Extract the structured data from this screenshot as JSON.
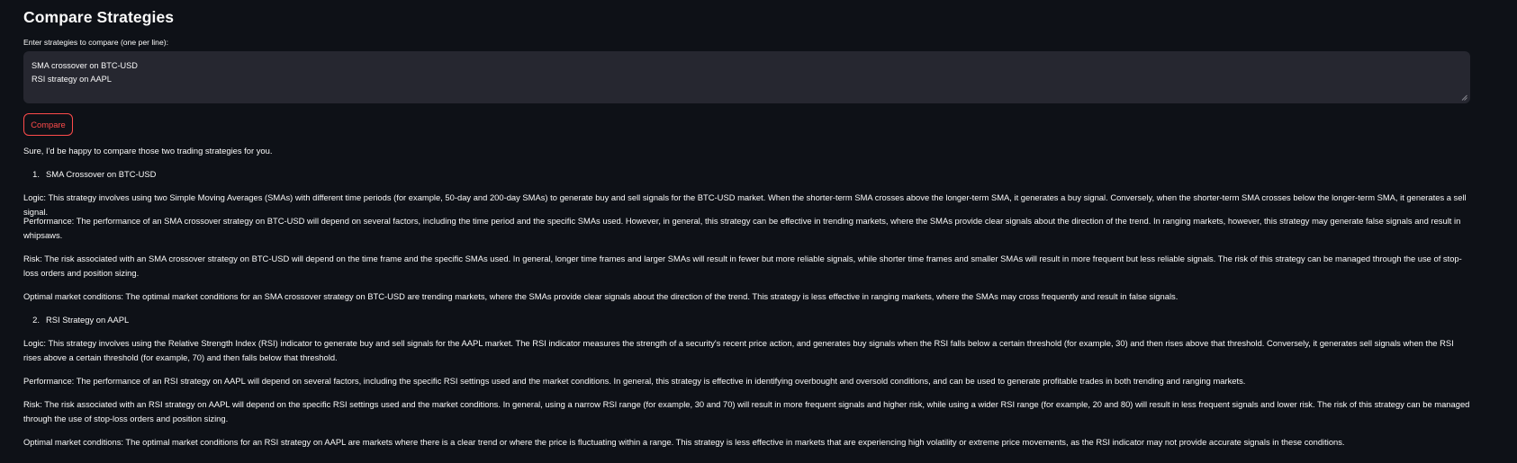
{
  "header": {
    "title": "Compare Strategies"
  },
  "input": {
    "label": "Enter strategies to compare (one per line):",
    "lines": [
      "SMA crossover on BTC-USD",
      "RSI strategy on AAPL"
    ]
  },
  "actions": {
    "compare_label": "Compare"
  },
  "result": {
    "intro": "Sure, I'd be happy to compare those two trading strategies for you.",
    "strategies": [
      {
        "number": "1.",
        "title": "SMA Crossover on BTC-USD",
        "logic": "Logic: This strategy involves using two Simple Moving Averages (SMAs) with different time periods (for example, 50-day and 200-day SMAs) to generate buy and sell signals for the BTC-USD market. When the shorter-term SMA crosses above the longer-term SMA, it generates a buy signal. Conversely, when the shorter-term SMA crosses below the longer-term SMA, it generates a sell signal.",
        "performance": "Performance: The performance of an SMA crossover strategy on BTC-USD will depend on several factors, including the time period and the specific SMAs used. However, in general, this strategy can be effective in trending markets, where the SMAs provide clear signals about the direction of the trend. In ranging markets, however, this strategy may generate false signals and result in whipsaws.",
        "risk": "Risk: The risk associated with an SMA crossover strategy on BTC-USD will depend on the time frame and the specific SMAs used. In general, longer time frames and larger SMAs will result in fewer but more reliable signals, while shorter time frames and smaller SMAs will result in more frequent but less reliable signals. The risk of this strategy can be managed through the use of stop-loss orders and position sizing.",
        "conditions": "Optimal market conditions: The optimal market conditions for an SMA crossover strategy on BTC-USD are trending markets, where the SMAs provide clear signals about the direction of the trend. This strategy is less effective in ranging markets, where the SMAs may cross frequently and result in false signals."
      },
      {
        "number": "2.",
        "title": "RSI Strategy on AAPL",
        "logic": "Logic: This strategy involves using the Relative Strength Index (RSI) indicator to generate buy and sell signals for the AAPL market. The RSI indicator measures the strength of a security's recent price action, and generates buy signals when the RSI falls below a certain threshold (for example, 30) and then rises above that threshold. Conversely, it generates sell signals when the RSI rises above a certain threshold (for example, 70) and then falls below that threshold.",
        "performance": "Performance: The performance of an RSI strategy on AAPL will depend on several factors, including the specific RSI settings used and the market conditions. In general, this strategy is effective in identifying overbought and oversold conditions, and can be used to generate profitable trades in both trending and ranging markets.",
        "risk": "Risk: The risk associated with an RSI strategy on AAPL will depend on the specific RSI settings used and the market conditions. In general, using a narrow RSI range (for example, 30 and 70) will result in more frequent signals and higher risk, while using a wider RSI range (for example, 20 and 80) will result in less frequent signals and lower risk. The risk of this strategy can be managed through the use of stop-loss orders and position sizing.",
        "conditions": "Optimal market conditions: The optimal market conditions for an RSI strategy on AAPL are markets where there is a clear trend or where the price is fluctuating within a range. This strategy is less effective in markets that are experiencing high volatility or extreme price movements, as the RSI indicator may not provide accurate signals in these conditions."
      }
    ]
  },
  "colors": {
    "background": "#0e1117",
    "text": "#fafafa",
    "input_background": "#262730",
    "accent": "#ff4b4b"
  },
  "icons": {
    "resize_handle": "resize-handle-icon"
  }
}
